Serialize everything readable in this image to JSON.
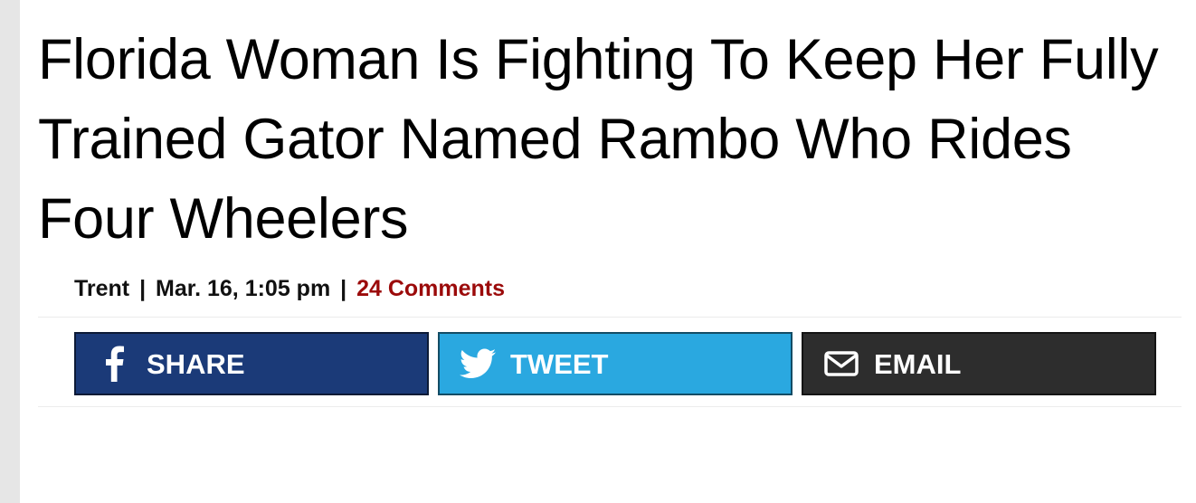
{
  "article": {
    "headline": "Florida Woman Is Fighting To Keep Her Fully Trained Gator Named Rambo Who Rides Four Wheelers",
    "byline": {
      "author": "Trent",
      "separator": "|",
      "date": "Mar. 16, 1:05 pm",
      "comments": "24 Comments"
    }
  },
  "share": {
    "facebook": {
      "label": "SHARE",
      "icon": "facebook-icon",
      "color": "#1b3a78"
    },
    "twitter": {
      "label": "TWEET",
      "icon": "twitter-bird-icon",
      "color": "#2aa8e0"
    },
    "email": {
      "label": "EMAIL",
      "icon": "envelope-icon",
      "color": "#2d2d2d"
    }
  },
  "colors": {
    "comments_link": "#9b0a0a",
    "left_rail": "#e6e6e6"
  }
}
